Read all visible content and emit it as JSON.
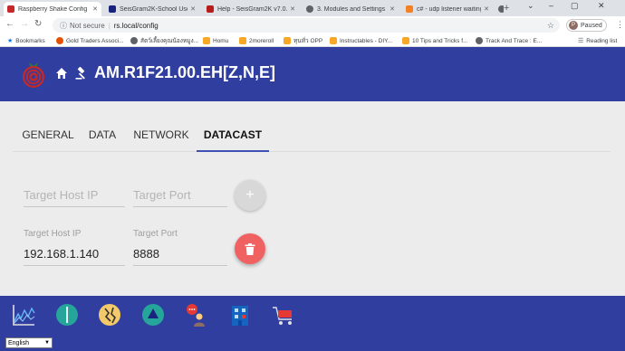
{
  "browser": {
    "tabs": [
      {
        "title": "Raspberry Shake Config",
        "active": true,
        "favicon_color": "#c62828"
      },
      {
        "title": "SeisGram2K-School Users",
        "active": false,
        "favicon_color": "#1a237e"
      },
      {
        "title": "Help - SeisGram2K v7.0.0",
        "active": false,
        "favicon_color": "#b71c1c"
      },
      {
        "title": "3. Modules and Settings -",
        "active": false,
        "favicon_color": "#5f6368"
      },
      {
        "title": "c# - udp listener waiting",
        "active": false,
        "favicon_color": "#f48024"
      },
      {
        "title": "",
        "active": false,
        "favicon_color": "#5f6368"
      }
    ],
    "new_tab": "+",
    "window_controls": [
      "⌄",
      "–",
      "▢",
      "✕"
    ],
    "address": {
      "security_label": "Not secure",
      "url": "rs.local/config"
    },
    "profile": {
      "initial": "P",
      "status": "Paused"
    },
    "bookmarks": [
      {
        "label": "Bookmarks",
        "icon_color": "#1a73e8"
      },
      {
        "label": "Gold Traders Associ...",
        "icon_color": "#e65100"
      },
      {
        "label": "สัตว์เลี้ยงคุณน้องหมูง...",
        "icon_color": "#5f6368"
      },
      {
        "label": "Homu",
        "icon_color": "#f9a825"
      },
      {
        "label": "2moreroll",
        "icon_color": "#f9a825"
      },
      {
        "label": "ทุนทั่ว OPP",
        "icon_color": "#f9a825"
      },
      {
        "label": "Instructables - DIY...",
        "icon_color": "#f9a825"
      },
      {
        "label": "10 Tips and Tricks f...",
        "icon_color": "#f9a825"
      },
      {
        "label": "Track And Trace : E...",
        "icon_color": "#5f6368"
      }
    ],
    "reading_list": "Reading list"
  },
  "header": {
    "station": "AM.R1F21.00.EH[Z,N,E]",
    "bg_color": "#303f9f"
  },
  "tabs": [
    {
      "label": "GENERAL",
      "active": false
    },
    {
      "label": "DATA",
      "active": false
    },
    {
      "label": "NETWORK",
      "active": false
    },
    {
      "label": "DATACAST",
      "active": true
    }
  ],
  "datacast": {
    "new_entry": {
      "host_placeholder": "Target Host IP",
      "port_placeholder": "Target Port"
    },
    "entries": [
      {
        "host_label": "Target Host IP",
        "host_value": "192.168.1.140",
        "port_label": "Target Port",
        "port_value": "8888"
      }
    ],
    "delete_color": "#f06262"
  },
  "bottom_nav": [
    {
      "icon": "chart-icon"
    },
    {
      "icon": "helicorder-icon"
    },
    {
      "icon": "earthquake-icon"
    },
    {
      "icon": "triangle-icon"
    },
    {
      "icon": "user-chat-icon"
    },
    {
      "icon": "building-icon"
    },
    {
      "icon": "cart-icon"
    }
  ],
  "language": {
    "selected": "English"
  }
}
